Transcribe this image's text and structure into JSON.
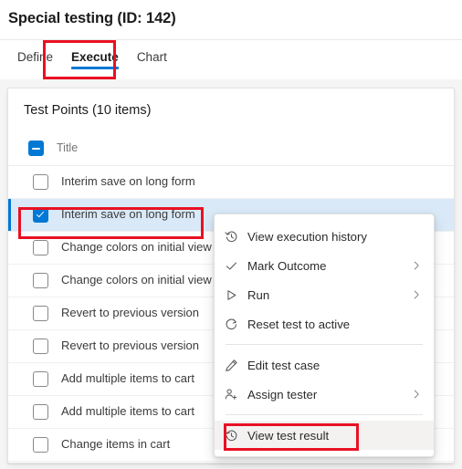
{
  "header": {
    "title": "Special testing (ID: 142)"
  },
  "tabs": [
    {
      "label": "Define",
      "active": false
    },
    {
      "label": "Execute",
      "active": true
    },
    {
      "label": "Chart",
      "active": false
    }
  ],
  "panel": {
    "title": "Test Points (10 items)",
    "column_header": "Title",
    "header_checkbox_state": "indeterminate",
    "rows": [
      {
        "label": "Interim save on long form",
        "checked": false,
        "selected": false
      },
      {
        "label": "Interim save on long form",
        "checked": true,
        "selected": true
      },
      {
        "label": "Change colors on initial view",
        "checked": false,
        "selected": false
      },
      {
        "label": "Change colors on initial view",
        "checked": false,
        "selected": false
      },
      {
        "label": "Revert to previous version",
        "checked": false,
        "selected": false
      },
      {
        "label": "Revert to previous version",
        "checked": false,
        "selected": false
      },
      {
        "label": "Add multiple items to cart",
        "checked": false,
        "selected": false
      },
      {
        "label": "Add multiple items to cart",
        "checked": false,
        "selected": false
      },
      {
        "label": "Change items in cart",
        "checked": false,
        "selected": false
      }
    ]
  },
  "context_menu": {
    "items": [
      {
        "label": "View execution history",
        "icon": "history-clock-icon",
        "submenu": false,
        "hovered": false
      },
      {
        "label": "Mark Outcome",
        "icon": "checkmark-icon",
        "submenu": true,
        "hovered": false
      },
      {
        "label": "Run",
        "icon": "play-triangle-icon",
        "submenu": true,
        "hovered": false
      },
      {
        "label": "Reset test to active",
        "icon": "refresh-circle-icon",
        "submenu": false,
        "hovered": false
      },
      {
        "separator": true
      },
      {
        "label": "Edit test case",
        "icon": "pencil-icon",
        "submenu": false,
        "hovered": false
      },
      {
        "label": "Assign tester",
        "icon": "person-add-icon",
        "submenu": true,
        "hovered": false
      },
      {
        "separator": true
      },
      {
        "label": "View test result",
        "icon": "history-clock-icon",
        "submenu": false,
        "hovered": true
      }
    ]
  },
  "colors": {
    "accent": "#0078d4",
    "annotation": "#e81123",
    "selected_row": "#d9e9f7",
    "menu_hover": "#f3f2f1"
  }
}
